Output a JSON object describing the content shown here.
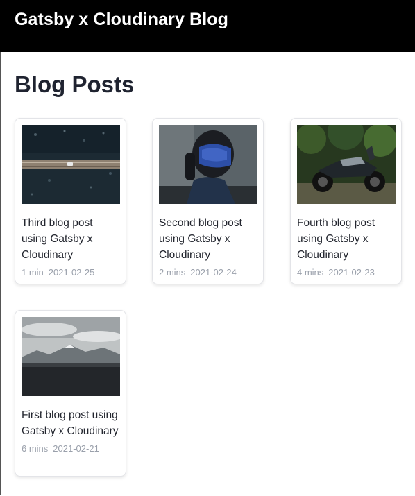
{
  "header": {
    "site_title": "Gatsby x Cloudinary Blog"
  },
  "main": {
    "page_title": "Blog Posts",
    "posts": [
      {
        "title": "Third blog post using Gatsby x Cloudinary",
        "read_time": "1 min",
        "date": "2021-02-25",
        "image": "aerial-bridge-over-water"
      },
      {
        "title": "Second blog post using Gatsby x Cloudinary",
        "read_time": "2 mins",
        "date": "2021-02-24",
        "image": "helmeted-motorcycle-rider"
      },
      {
        "title": "Fourth blog post using Gatsby x Cloudinary",
        "read_time": "4 mins",
        "date": "2021-02-23",
        "image": "parked-motorcycle-in-forest"
      },
      {
        "title": "First blog post using Gatsby x Cloudinary",
        "read_time": "6 mins",
        "date": "2021-02-21",
        "image": "mountain-landscape-cloudy-sky"
      }
    ]
  },
  "colors": {
    "header_bg": "#000000",
    "text": "#1f2330",
    "meta": "#9aa0ab",
    "card_border": "#e3e4e8"
  }
}
